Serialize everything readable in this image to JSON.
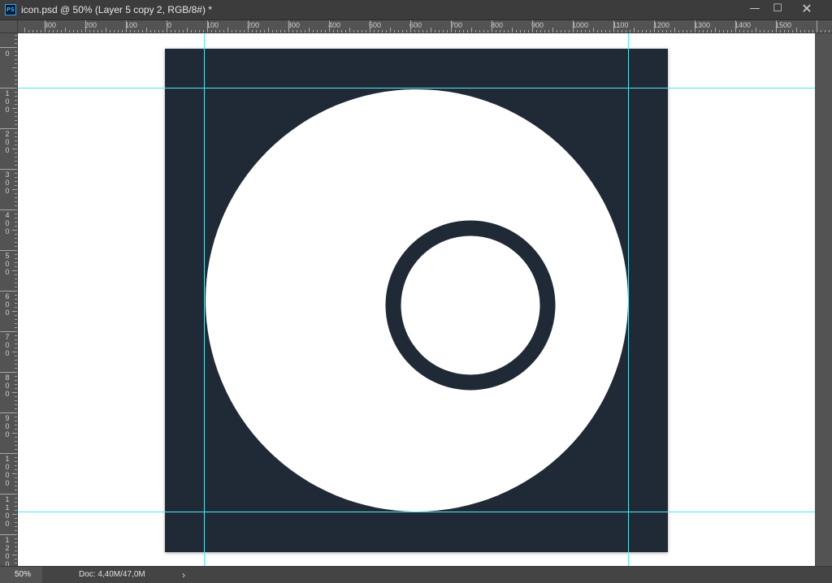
{
  "window": {
    "title": "icon.psd @ 50% (Layer 5 copy 2, RGB/8#) *",
    "app_icon": "PS",
    "minimize_glyph": "—",
    "maximize_glyph": "☐",
    "close_glyph": "✕"
  },
  "ruler_top_labels": [
    "300",
    "200",
    "100",
    "0",
    "100",
    "200",
    "300",
    "400",
    "500",
    "600",
    "700",
    "800",
    "900",
    "1000",
    "1100",
    "1200",
    "1300",
    "1400",
    "1500"
  ],
  "ruler_left_labels": [
    "0",
    "100",
    "200",
    "300",
    "400",
    "500",
    "600",
    "700",
    "800",
    "900",
    "1000",
    "1100",
    "1200"
  ],
  "canvas": {
    "background": "#ffffff",
    "artboard_color": "#202a36",
    "disc_color": "#ffffff",
    "guide_color": "#4fe7f0"
  },
  "status": {
    "zoom": "50%",
    "doc": "Doc: 4,40M/47,0M",
    "arrow": "›"
  }
}
